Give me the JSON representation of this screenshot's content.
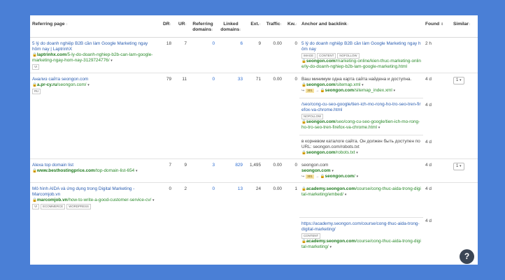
{
  "columns": {
    "referring_page": "Referring page",
    "dr": "DR",
    "ur": "UR",
    "referring_domains": "Referring domains",
    "linked_domains": "Linked domains",
    "ext": "Ext.",
    "traffic": "Traffic",
    "kw": "Kw.",
    "anchor_backlink": "Anchor and backlink",
    "found": "Found",
    "similar": "Similar"
  },
  "rows": [
    {
      "title": "5 lý do doanh nghiệp B2B cần làm Google Marketing ngay hôm nay | LaptrinhX",
      "domain": "laptrinhx.com",
      "path": "/5-ly-do-doanh-nghiep-b2b-can-lam-google-marketing-ngay-hom-nay-3129724776/",
      "tags": [
        "VI"
      ],
      "dr": "18",
      "ur": "7",
      "ref_domains": "0",
      "linked_domains": "6",
      "ext": "9",
      "traffic": "0.00",
      "kw": "0",
      "backlinks": [
        {
          "anchor": "5 lý do doanh nghiệp B2B cần làm Google Marketing ngay hôm nay",
          "tags": [
            "IMAGE",
            "CONTENT",
            "NOFOLLOW"
          ],
          "domain": "seongon.com",
          "path": "/marketing-online/kien-thuc-marketing-online/ly-do-doanh-nghiep-b2b-lam-google-marketing.html",
          "found": "2 h",
          "similar": ""
        }
      ]
    },
    {
      "title": "Анализ сайта seongon.com",
      "domain": "a.pr-cy.ru",
      "path": "/seongon.com/",
      "tags": [
        "RU"
      ],
      "dr": "79",
      "ur": "11",
      "ref_domains": "0",
      "linked_domains": "33",
      "ext": "71",
      "traffic": "0.00",
      "kw": "0",
      "backlinks": [
        {
          "anchor_plain": "Ваш минимум одна карта сайта найдена и доступна.",
          "domain": "seongon.com",
          "path": "/sitemap.xml",
          "redirect": "301",
          "redirect_domain": "seongon.com",
          "redirect_path": "/sitemap_index.xml",
          "found": "4 d",
          "similar": "1"
        },
        {
          "anchor": "/seo/cong-cu-seo-google/tien-ich-mo-rong-ho-tro-seo-tren-firefox-va-chrome.html",
          "tags": [
            "NOFOLLOW"
          ],
          "domain": "seongon.com",
          "path": "/seo/cong-cu-seo-google/tien-ich-mo-rong-ho-tro-seo-tren-firefox-va-chrome.html",
          "found": "4 d",
          "similar": ""
        },
        {
          "anchor_plain": "в корневом каталоге сайта. Он должен быть доступен по URL: seongon.com/robots.txt",
          "domain": "seongon.com",
          "path": "/robots.txt",
          "found": "4 d",
          "similar": ""
        }
      ]
    },
    {
      "title": "Alexa top domain list",
      "domain": "www.besthostingprice.com",
      "path": "/top-domain-list-654",
      "tags": [],
      "dr": "7",
      "ur": "9",
      "ref_domains": "3",
      "linked_domains": "829",
      "ext": "1,495",
      "traffic": "0.00",
      "kw": "0",
      "backlinks": [
        {
          "anchor_plain": "seongon.com",
          "domain": "seongon.com",
          "path": "",
          "redirect": "301",
          "redirect_domain": "seongon.com",
          "redirect_path": "/",
          "found": "4 d",
          "similar": "1"
        }
      ]
    },
    {
      "title": "Mô hình AIDA và ứng dụng trong Digital Marketing - Marcomjob.vn",
      "domain": "marcomjob.vn",
      "path": "/how-to-write-a-good-customer-service-cv/",
      "tags": [
        "VI",
        "ECOMMERCE",
        "WORDPRESS"
      ],
      "dr": "0",
      "ur": "2",
      "ref_domains": "0",
      "linked_domains": "13",
      "ext": "24",
      "traffic": "0.00",
      "kw": "1",
      "backlinks": [
        {
          "domain": "academy.seongon.com",
          "path": "/course/cong-thuc-aida-trong-digital-marketing/embed/",
          "found": "4 d",
          "similar": ""
        },
        {
          "anchor": "https://academy.seongon.com/course/cong-thuc-aida-trong-digital-marketing/",
          "tags": [
            "CONTENT"
          ],
          "domain": "academy.seongon.com",
          "path": "/course/cong-thuc-aida-trong-digital-marketing/",
          "found": "4 d",
          "similar": ""
        }
      ]
    }
  ],
  "help_label": "?"
}
